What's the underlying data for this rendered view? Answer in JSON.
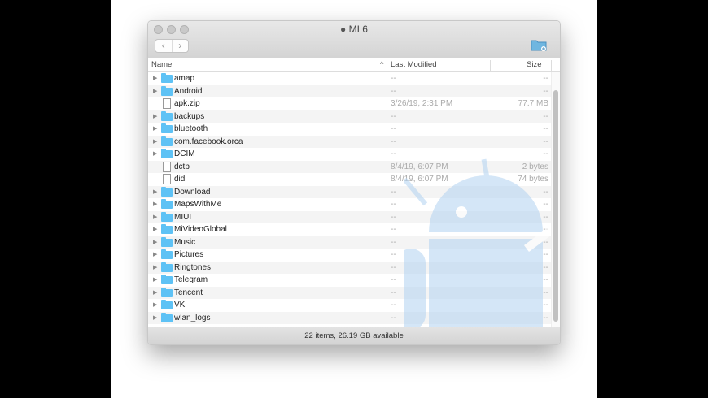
{
  "window": {
    "title": "MI 6",
    "back": "‹",
    "forward": "›"
  },
  "columns": {
    "name": "Name",
    "modified": "Last Modified",
    "size": "Size",
    "sort": "^"
  },
  "rows": [
    {
      "name": "amap",
      "type": "folder",
      "modified": "--",
      "size": "--"
    },
    {
      "name": "Android",
      "type": "folder",
      "modified": "--",
      "size": "--"
    },
    {
      "name": "apk.zip",
      "type": "file",
      "modified": "3/26/19, 2:31 PM",
      "size": "77.7 MB"
    },
    {
      "name": "backups",
      "type": "folder",
      "modified": "--",
      "size": "--"
    },
    {
      "name": "bluetooth",
      "type": "folder",
      "modified": "--",
      "size": "--"
    },
    {
      "name": "com.facebook.orca",
      "type": "folder",
      "modified": "--",
      "size": "--"
    },
    {
      "name": "DCIM",
      "type": "folder",
      "modified": "--",
      "size": "--"
    },
    {
      "name": "dctp",
      "type": "file",
      "modified": "8/4/19, 6:07 PM",
      "size": "2 bytes"
    },
    {
      "name": "did",
      "type": "file",
      "modified": "8/4/19, 6:07 PM",
      "size": "74 bytes"
    },
    {
      "name": "Download",
      "type": "folder",
      "modified": "--",
      "size": "--"
    },
    {
      "name": "MapsWithMe",
      "type": "folder",
      "modified": "--",
      "size": "--"
    },
    {
      "name": "MIUI",
      "type": "folder",
      "modified": "--",
      "size": "--"
    },
    {
      "name": "MiVideoGlobal",
      "type": "folder",
      "modified": "--",
      "size": "--"
    },
    {
      "name": "Music",
      "type": "folder",
      "modified": "--",
      "size": "--"
    },
    {
      "name": "Pictures",
      "type": "folder",
      "modified": "--",
      "size": "--"
    },
    {
      "name": "Ringtones",
      "type": "folder",
      "modified": "--",
      "size": "--"
    },
    {
      "name": "Telegram",
      "type": "folder",
      "modified": "--",
      "size": "--"
    },
    {
      "name": "Tencent",
      "type": "folder",
      "modified": "--",
      "size": "--"
    },
    {
      "name": "VK",
      "type": "folder",
      "modified": "--",
      "size": "--"
    },
    {
      "name": "wlan_logs",
      "type": "folder",
      "modified": "--",
      "size": "--"
    }
  ],
  "status": "22 items, 26.19 GB available",
  "colors": {
    "folder": "#5ec2f5",
    "watermark": "#b8d6f2"
  }
}
